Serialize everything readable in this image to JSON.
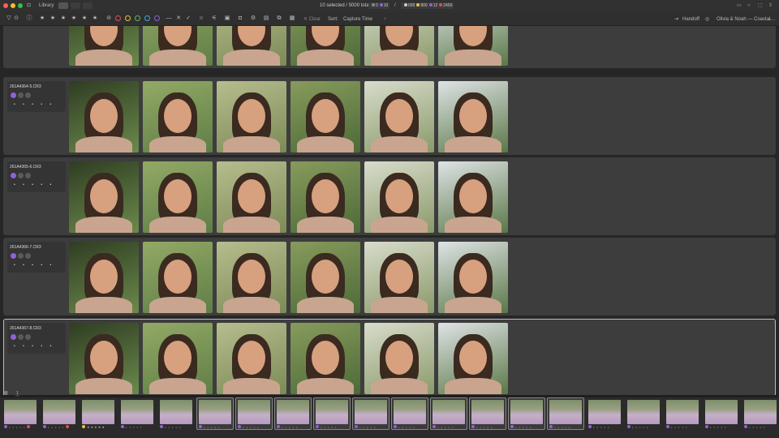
{
  "titlebar": {
    "section": "Library",
    "selection_status": "10 selected / 5000 total",
    "counters": [
      {
        "label": "0",
        "color": "#888888"
      },
      {
        "label": "10",
        "color": "#8e63d6"
      }
    ],
    "counters2": [
      {
        "label": "699",
        "color": "#cccccc"
      },
      {
        "label": "800",
        "color": "#e8c33a"
      },
      {
        "label": "12",
        "color": "#8e63d6"
      },
      {
        "label": "2400",
        "color": "#e04d5a"
      }
    ],
    "separator": "/"
  },
  "toolbar": {
    "clear_label": "Clear",
    "sort_label": "Sort:",
    "sort_value": "Capture Time",
    "handoff_label": "Handoff",
    "project_name": "Olivia & Noah — Coastal…",
    "color_circles": [
      "#e04d5a",
      "#e8c33a",
      "#5cb85c",
      "#4aa3df",
      "#8e63d6"
    ]
  },
  "colors": {
    "accent": "#8e63d6",
    "row_bg": "#3d3d3d",
    "selected_border": "#bdbdbd"
  },
  "rows": [
    {
      "filename": "",
      "partial": true
    },
    {
      "filename": "261A4364-5.CR3"
    },
    {
      "filename": "261A4365-6.CR3"
    },
    {
      "filename": "261A4366-7.CR3"
    },
    {
      "filename": "261A4367-8.CR3",
      "selected": true
    }
  ],
  "row_stars": "• • • • •",
  "filmstrip": {
    "toggle_label": "1",
    "items": [
      {
        "label": "• • • • •",
        "badge": "#8e63d6",
        "mark": "#e04d5a",
        "selected": false
      },
      {
        "label": "• • • • •",
        "badge": "#8e63d6",
        "mark": "#e04d5a",
        "selected": false
      },
      {
        "label": "★★★★★",
        "badge": "#e8c33a",
        "mark": "",
        "selected": false
      },
      {
        "label": "• • • • •",
        "badge": "#8e63d6",
        "mark": "",
        "selected": false
      },
      {
        "label": "• • • • •",
        "badge": "#8e63d6",
        "mark": "",
        "selected": false
      },
      {
        "label": "• • • • •",
        "badge": "#8e63d6",
        "mark": "",
        "selected": true
      },
      {
        "label": "• • • • •",
        "badge": "#8e63d6",
        "mark": "",
        "selected": true
      },
      {
        "label": "• • • • •",
        "badge": "#8e63d6",
        "mark": "",
        "selected": true
      },
      {
        "label": "• • • • •",
        "badge": "#8e63d6",
        "mark": "",
        "selected": true
      },
      {
        "label": "• • • • •",
        "badge": "#8e63d6",
        "mark": "",
        "selected": true
      },
      {
        "label": "• • • • •",
        "badge": "#8e63d6",
        "mark": "",
        "selected": true
      },
      {
        "label": "• • • • •",
        "badge": "#8e63d6",
        "mark": "",
        "selected": true
      },
      {
        "label": "• • • • •",
        "badge": "#8e63d6",
        "mark": "",
        "selected": true
      },
      {
        "label": "• • • • •",
        "badge": "#8e63d6",
        "mark": "",
        "selected": true
      },
      {
        "label": "• • • • •",
        "badge": "#8e63d6",
        "mark": "",
        "selected": true
      },
      {
        "label": "• • • • •",
        "badge": "#8e63d6",
        "mark": "",
        "selected": false
      },
      {
        "label": "• • • • •",
        "badge": "#8e63d6",
        "mark": "",
        "selected": false
      },
      {
        "label": "• • • • •",
        "badge": "#8e63d6",
        "mark": "",
        "selected": false
      },
      {
        "label": "• • • • •",
        "badge": "#8e63d6",
        "mark": "",
        "selected": false
      },
      {
        "label": "• • • • •",
        "badge": "#8e63d6",
        "mark": "",
        "selected": false
      }
    ]
  }
}
